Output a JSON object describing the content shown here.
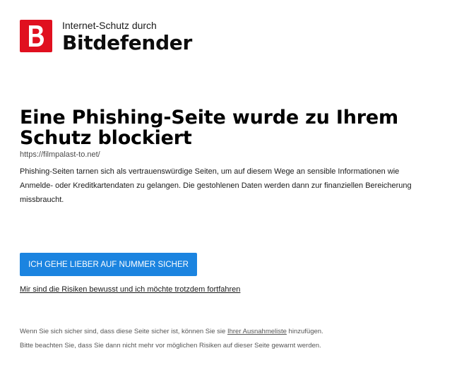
{
  "brand": {
    "logo_letter": "B",
    "logo_color": "#e0101f",
    "subtitle": "Internet-Schutz durch",
    "name": "Bitdefender"
  },
  "warning": {
    "headline": "Eine Phishing-Seite wurde zu Ihrem Schutz blockiert",
    "url": "https://filmpalast-to.net/",
    "description": "Phishing-Seiten tarnen sich als vertrauenswürdige Seiten, um auf diesem Wege an sensible Informationen wie Anmelde- oder Kreditkartendaten zu gelangen. Die gestohlenen Daten werden dann zur finanziellen Bereicherung missbraucht."
  },
  "actions": {
    "safe_button_label": "ICH GEHE LIEBER AUF NUMMER SICHER",
    "safe_button_color": "#1b84e0",
    "proceed_link_label": "Mir sind die Risiken bewusst und ich möchte trotzdem fortfahren"
  },
  "footer": {
    "line1_before": "Wenn Sie sich sicher sind, dass diese Seite sicher ist, können Sie sie ",
    "exceptions_link": "Ihrer Ausnahmeliste",
    "line1_after": " hinzufügen.",
    "line2": "Bitte beachten Sie, dass Sie dann nicht mehr vor möglichen Risiken auf dieser Seite gewarnt werden."
  }
}
